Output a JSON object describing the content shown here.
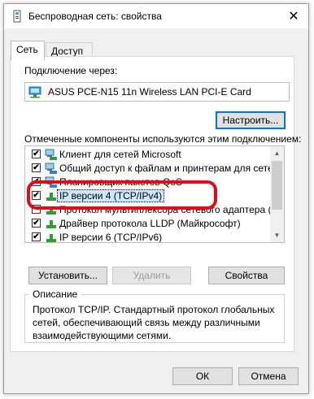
{
  "window": {
    "title": "Беспроводная сеть: свойства",
    "close_glyph": "✕"
  },
  "tabs": [
    "Сеть",
    "Доступ"
  ],
  "connect_label": "Подключение через:",
  "adapter_name": "ASUS PCE-N15 11n Wireless LAN PCI-E Card",
  "configure_label": "Настроить...",
  "components_label": "Отмеченные компоненты используются этим подключением:",
  "components": [
    {
      "label": "Клиент для сетей Microsoft",
      "checked": true,
      "icon": "network-client-icon"
    },
    {
      "label": "Общий доступ к файлам и принтерам для сетей Mi",
      "checked": true,
      "icon": "network-service-icon"
    },
    {
      "label": "Планировщик пакетов QoS",
      "checked": true,
      "icon": "network-service-icon"
    },
    {
      "label": "IP версии 4 (TCP/IPv4)",
      "checked": true,
      "icon": "protocol-icon",
      "selected": true
    },
    {
      "label": "Протокол мультиплексора сетевого адаптера (Ma",
      "checked": false,
      "icon": "protocol-icon"
    },
    {
      "label": "Драйвер протокола LLDP (Майкрософт)",
      "checked": true,
      "icon": "protocol-icon"
    },
    {
      "label": "IP версии 6 (TCP/IPv6)",
      "checked": true,
      "icon": "protocol-icon"
    }
  ],
  "buttons": {
    "install": "Установить...",
    "remove": "Удалить",
    "properties": "Свойства",
    "ok": "ОК",
    "cancel": "Отмена"
  },
  "description": {
    "title": "Описание",
    "text": "Протокол TCP/IP. Стандартный протокол глобальных сетей, обеспечивающий связь между различными взаимодействующими сетями."
  },
  "colors": {
    "highlight_border": "#e10a1a",
    "selection": "#cce8ff",
    "focus": "#0078d7"
  }
}
